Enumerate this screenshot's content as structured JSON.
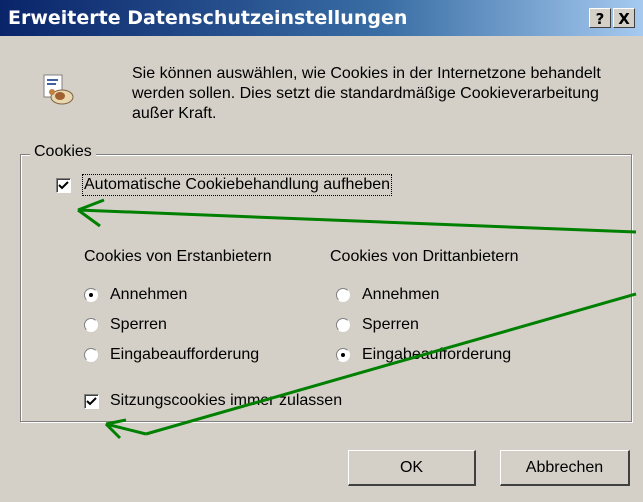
{
  "window": {
    "title": "Erweiterte Datenschutzeinstellungen",
    "help_button": "?",
    "close_button": "X"
  },
  "intro_text": "Sie können auswählen, wie Cookies in der Internetzone behandelt werden sollen. Dies setzt die standardmäßige Cookieverarbeitung außer Kraft.",
  "cookies_group": {
    "legend": "Cookies",
    "override_checkbox": {
      "label": "Automatische Cookiebehandlung aufheben",
      "checked": true
    },
    "first_party": {
      "heading": "Cookies von Erstanbietern",
      "options": [
        "Annehmen",
        "Sperren",
        "Eingabeaufforderung"
      ],
      "selected": "Annehmen"
    },
    "third_party": {
      "heading": "Cookies von Drittanbietern",
      "options": [
        "Annehmen",
        "Sperren",
        "Eingabeaufforderung"
      ],
      "selected": "Eingabeaufforderung"
    },
    "session_checkbox": {
      "label": "Sitzungscookies immer zulassen",
      "checked": true
    }
  },
  "buttons": {
    "ok": "OK",
    "cancel": "Abbrechen"
  },
  "colors": {
    "dialog_bg": "#d4d0c8",
    "titlebar_start": "#0a246a",
    "titlebar_end": "#a6caf0",
    "annotation_arrow": "#008000"
  }
}
